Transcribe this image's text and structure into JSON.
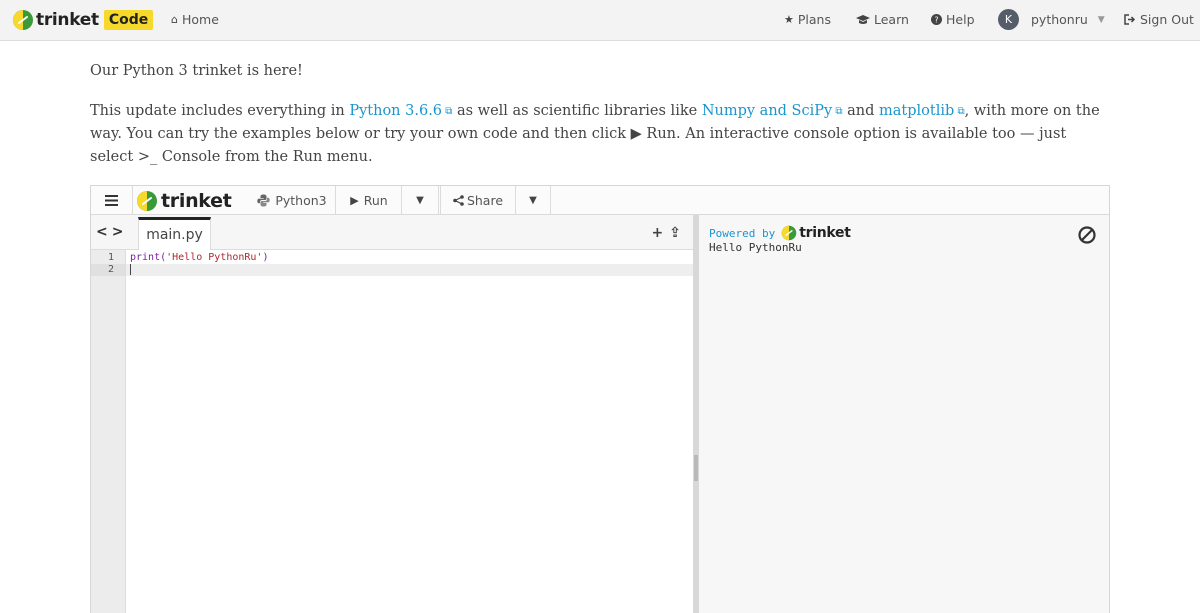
{
  "navbar": {
    "brand": "trinket",
    "brand_badge": "Code",
    "home": "Home",
    "plans": "Plans",
    "learn": "Learn",
    "help": "Help",
    "avatar_initial": "K",
    "username": "pythonru",
    "sign_out": "Sign Out"
  },
  "intro": {
    "heading": "Our Python 3 trinket is here!",
    "p_start": "This update includes everything in ",
    "link_python": "Python 3.6.6",
    "p_mid1": " as well as scientific libraries like ",
    "link_numpy": "Numpy and SciPy",
    "p_mid2": " and ",
    "link_matplotlib": "matplotlib",
    "p_mid3": ", with more on the way. You can try the examples below or try your own code and then click ",
    "run_label": "▶ Run",
    "p_mid4": ". An interactive console option is available too — just select ",
    "console_label": ">_ Console",
    "p_end": " from the Run menu."
  },
  "embed": {
    "toolbar": {
      "brand": "trinket",
      "language": "Python3",
      "run": "Run",
      "share": "Share"
    },
    "file_tab": "main.py",
    "code": {
      "line_numbers": [
        "1",
        "2"
      ],
      "line1_fn": "print(",
      "line1_str": "'Hello PythonRu'",
      "line1_end": ")"
    },
    "output": {
      "powered_by": "Powered by",
      "powered_brand": "trinket",
      "text": "Hello PythonRu"
    }
  },
  "colors": {
    "brand_yellow": "#f6d92b",
    "brand_green": "#3a9a3a",
    "link": "#1a95cf"
  },
  "icons": [
    "home-icon",
    "star-icon",
    "graduation-cap-icon",
    "question-circle-icon",
    "sign-out-icon",
    "menu-icon",
    "python-icon",
    "play-icon",
    "share-icon",
    "chevron-down-icon",
    "plus-icon",
    "upload-icon",
    "ban-icon",
    "external-link-icon"
  ]
}
